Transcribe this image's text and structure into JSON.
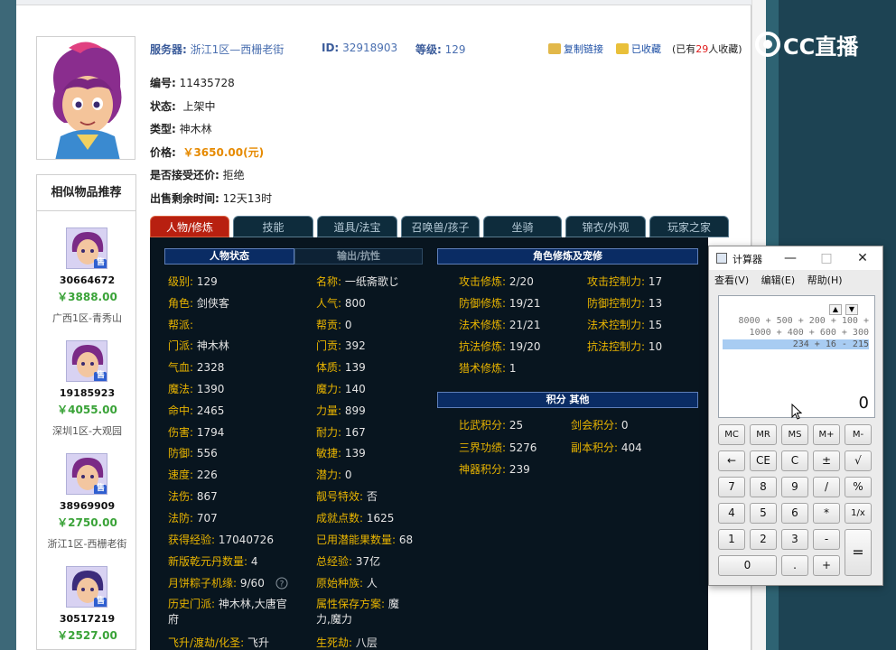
{
  "header": {
    "server_label": "服务器:",
    "server_value": "浙江1区—西栅老街",
    "id_label": "ID:",
    "id_value": "32918903",
    "level_label": "等级:",
    "level_value": "129",
    "copy_link": "复制链接",
    "favorited": "已收藏",
    "fav_prefix": "(已有",
    "fav_num": "29",
    "fav_suffix": "人收藏)"
  },
  "info": {
    "number_label": "编号:",
    "number_value": "11435728",
    "status_label": "状态:",
    "status_value": "上架中",
    "type_label": "类型:",
    "type_value": "神木林",
    "price_label": "价格:",
    "price_value": "￥3650.00(元)",
    "bargain_label": "是否接受还价:",
    "bargain_value": "拒绝",
    "time_label": "出售剩余时间:",
    "time_value": "12天13时"
  },
  "tabs": [
    "人物/修炼",
    "技能",
    "道具/法宝",
    "召唤兽/孩子",
    "坐骑",
    "锦衣/外观",
    "玩家之家"
  ],
  "sections": {
    "char_state": "人物状态",
    "output_resist": "输出/抗性",
    "cultivation": "角色修炼及宠修",
    "points_other": "积分 其他"
  },
  "stats_left": [
    {
      "k": "级别:",
      "v": "129"
    },
    {
      "k": "角色:",
      "v": "剑侠客"
    },
    {
      "k": "帮派:",
      "v": ""
    },
    {
      "k": "门派:",
      "v": "神木林"
    },
    {
      "k": "气血:",
      "v": "2328"
    },
    {
      "k": "魔法:",
      "v": "1390"
    },
    {
      "k": "命中:",
      "v": "2465"
    },
    {
      "k": "伤害:",
      "v": "1794"
    },
    {
      "k": "防御:",
      "v": "556"
    },
    {
      "k": "速度:",
      "v": "226"
    },
    {
      "k": "法伤:",
      "v": "867"
    },
    {
      "k": "法防:",
      "v": "707"
    },
    {
      "k": "获得经验:",
      "v": "17040726"
    },
    {
      "k": "新版乾元丹数量:",
      "v": "4"
    },
    {
      "k": "月饼粽子机缘:",
      "v": "9/60"
    },
    {
      "k": "历史门派:",
      "v": "神木林,大唐官"
    },
    {
      "k": "府",
      "v": ""
    },
    {
      "k": "飞升/渡劫/化圣:",
      "v": "飞升"
    }
  ],
  "stats_mid": [
    {
      "k": "名称:",
      "v": "一纸斋歌じ"
    },
    {
      "k": "人气:",
      "v": "800"
    },
    {
      "k": "帮贡:",
      "v": "0"
    },
    {
      "k": "门贡:",
      "v": "392"
    },
    {
      "k": "体质:",
      "v": "139"
    },
    {
      "k": "魔力:",
      "v": "140"
    },
    {
      "k": "力量:",
      "v": "899"
    },
    {
      "k": "耐力:",
      "v": "167"
    },
    {
      "k": "敏捷:",
      "v": "139"
    },
    {
      "k": "潜力:",
      "v": "0"
    },
    {
      "k": "靓号特效:",
      "v": "否"
    },
    {
      "k": "成就点数:",
      "v": "1625"
    },
    {
      "k": "已用潜能果数量:",
      "v": "68"
    },
    {
      "k": "总经验:",
      "v": "37亿"
    },
    {
      "k": "原始种族:",
      "v": "人"
    },
    {
      "k": "属性保存方案:",
      "v": "魔"
    },
    {
      "k": "力,魔力",
      "v": ""
    },
    {
      "k": "生死劫:",
      "v": "八层"
    }
  ],
  "cultivation_left": [
    {
      "k": "攻击修炼:",
      "v": "2/20"
    },
    {
      "k": "防御修炼:",
      "v": "19/21"
    },
    {
      "k": "法术修炼:",
      "v": "21/21"
    },
    {
      "k": "抗法修炼:",
      "v": "19/20"
    },
    {
      "k": "猎术修炼:",
      "v": "1"
    }
  ],
  "cultivation_right": [
    {
      "k": "攻击控制力:",
      "v": "17"
    },
    {
      "k": "防御控制力:",
      "v": "13"
    },
    {
      "k": "法术控制力:",
      "v": "15"
    },
    {
      "k": "抗法控制力:",
      "v": "10"
    }
  ],
  "points_left": [
    {
      "k": "比武积分:",
      "v": "25"
    },
    {
      "k": "三界功绩:",
      "v": "5276"
    },
    {
      "k": "神器积分:",
      "v": "239"
    }
  ],
  "points_right": [
    {
      "k": "剑会积分:",
      "v": "0"
    },
    {
      "k": "副本积分:",
      "v": "404"
    }
  ],
  "sidebar": {
    "title": "相似物品推荐",
    "sell_badge": "售",
    "items": [
      {
        "id": "30664672",
        "price": "￥3888.00",
        "server": "广西1区-青秀山"
      },
      {
        "id": "19185923",
        "price": "￥4055.00",
        "server": "深圳1区-大观园"
      },
      {
        "id": "38969909",
        "price": "￥2750.00",
        "server": "浙江1区-西栅老街"
      },
      {
        "id": "30517219",
        "price": "￥2527.00",
        "server": ""
      }
    ]
  },
  "logo": {
    "text": "CC直播"
  },
  "calculator": {
    "title": "计算器",
    "menu": [
      "查看(V)",
      "编辑(E)",
      "帮助(H)"
    ],
    "history": [
      "8000 + 500 + 200 + 100 +",
      "1000 + 400 + 600 + 300",
      "234 + 16 - 215"
    ],
    "result": "0",
    "keys": [
      [
        "MC",
        "MR",
        "MS",
        "M+",
        "M-"
      ],
      [
        "←",
        "CE",
        "C",
        "±",
        "√"
      ],
      [
        "7",
        "8",
        "9",
        "/",
        "%"
      ],
      [
        "4",
        "5",
        "6",
        "*",
        "1/x"
      ],
      [
        "1",
        "2",
        "3",
        "-",
        "="
      ],
      [
        "0",
        ".",
        "+"
      ]
    ]
  }
}
